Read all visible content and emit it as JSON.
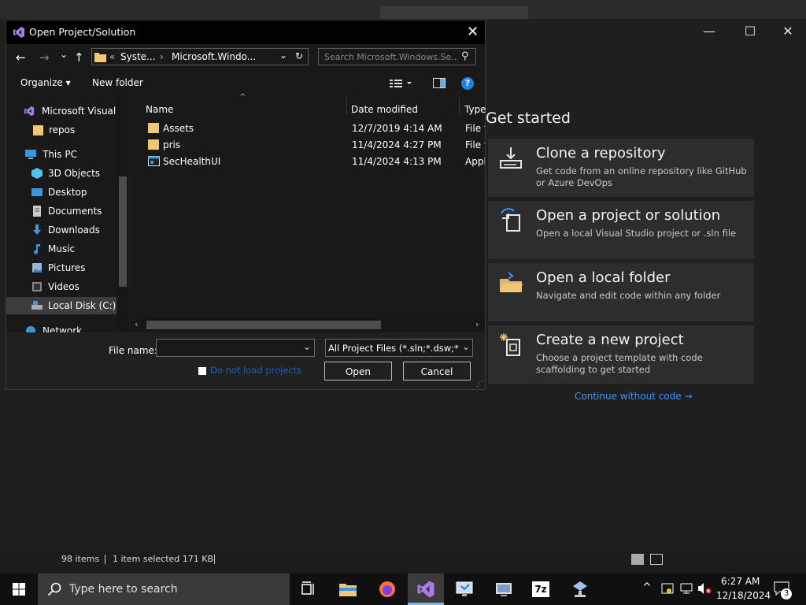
{
  "vs_start": {
    "heading": "Get started",
    "cards": [
      {
        "title": "Clone a repository",
        "desc": "Get code from an online repository like GitHub or Azure DevOps",
        "icon": "clone-icon"
      },
      {
        "title": "Open a project or solution",
        "desc": "Open a local Visual Studio project or .sln file",
        "icon": "open-project-icon"
      },
      {
        "title": "Open a local folder",
        "desc": "Navigate and edit code within any folder",
        "icon": "open-folder-icon"
      },
      {
        "title": "Create a new project",
        "desc": "Choose a project template with code scaffolding to get started",
        "icon": "new-project-icon"
      }
    ],
    "continue_link": "Continue without code →",
    "window_controls": {
      "minimize": "—",
      "maximize": "☐",
      "close": "✕"
    }
  },
  "dialog": {
    "title": "Open Project/Solution",
    "close_glyph": "✕",
    "nav": {
      "back": "←",
      "forward": "→",
      "recent": "⌄",
      "up": "↑"
    },
    "address": {
      "prefix": "«",
      "seg1": "Syste...",
      "sep": "›",
      "seg2": "Microsoft.Windo...",
      "dropdown": "⌄",
      "refresh": "↻"
    },
    "search_placeholder": "Search Microsoft.Windows.Se...",
    "search_icon": "⚲",
    "toolbar": {
      "organize": "Organize ▾",
      "new_folder": "New folder",
      "help": "?"
    },
    "nav_pane": [
      {
        "label": "Microsoft Visual S",
        "icon": "visual-studio-icon"
      },
      {
        "label": "repos",
        "icon": "folder-icon"
      },
      {
        "label": "This PC",
        "icon": "this-pc-icon"
      },
      {
        "label": "3D Objects",
        "icon": "3d-objects-icon"
      },
      {
        "label": "Desktop",
        "icon": "desktop-icon"
      },
      {
        "label": "Documents",
        "icon": "documents-icon"
      },
      {
        "label": "Downloads",
        "icon": "downloads-icon"
      },
      {
        "label": "Music",
        "icon": "music-icon"
      },
      {
        "label": "Pictures",
        "icon": "pictures-icon"
      },
      {
        "label": "Videos",
        "icon": "videos-icon"
      },
      {
        "label": "Local Disk (C:)",
        "icon": "local-disk-icon"
      },
      {
        "label": "Network",
        "icon": "network-icon"
      }
    ],
    "columns": {
      "name": "Name",
      "date": "Date modified",
      "type": "Type"
    },
    "files": [
      {
        "name": "Assets",
        "date": "12/7/2019 4:14 AM",
        "type": "File fo",
        "icon": "folder-icon"
      },
      {
        "name": "pris",
        "date": "11/4/2024 4:27 PM",
        "type": "File fo",
        "icon": "folder-icon"
      },
      {
        "name": "SecHealthUI",
        "date": "11/4/2024 4:13 PM",
        "type": "Appli",
        "icon": "app-icon"
      }
    ],
    "file_name_label": "File name:",
    "file_name_value": "",
    "filter": "All Project Files (*.sln;*.dsw;*.vc",
    "do_not_load": "Do not load projects",
    "open": "Open",
    "cancel": "Cancel"
  },
  "statusbar": {
    "items": "98 items",
    "selected": "1 item selected  171 KB"
  },
  "taskbar": {
    "search_placeholder": "Type here to search",
    "time": "6:27 AM",
    "date": "12/18/2024",
    "notification_count": "3"
  }
}
